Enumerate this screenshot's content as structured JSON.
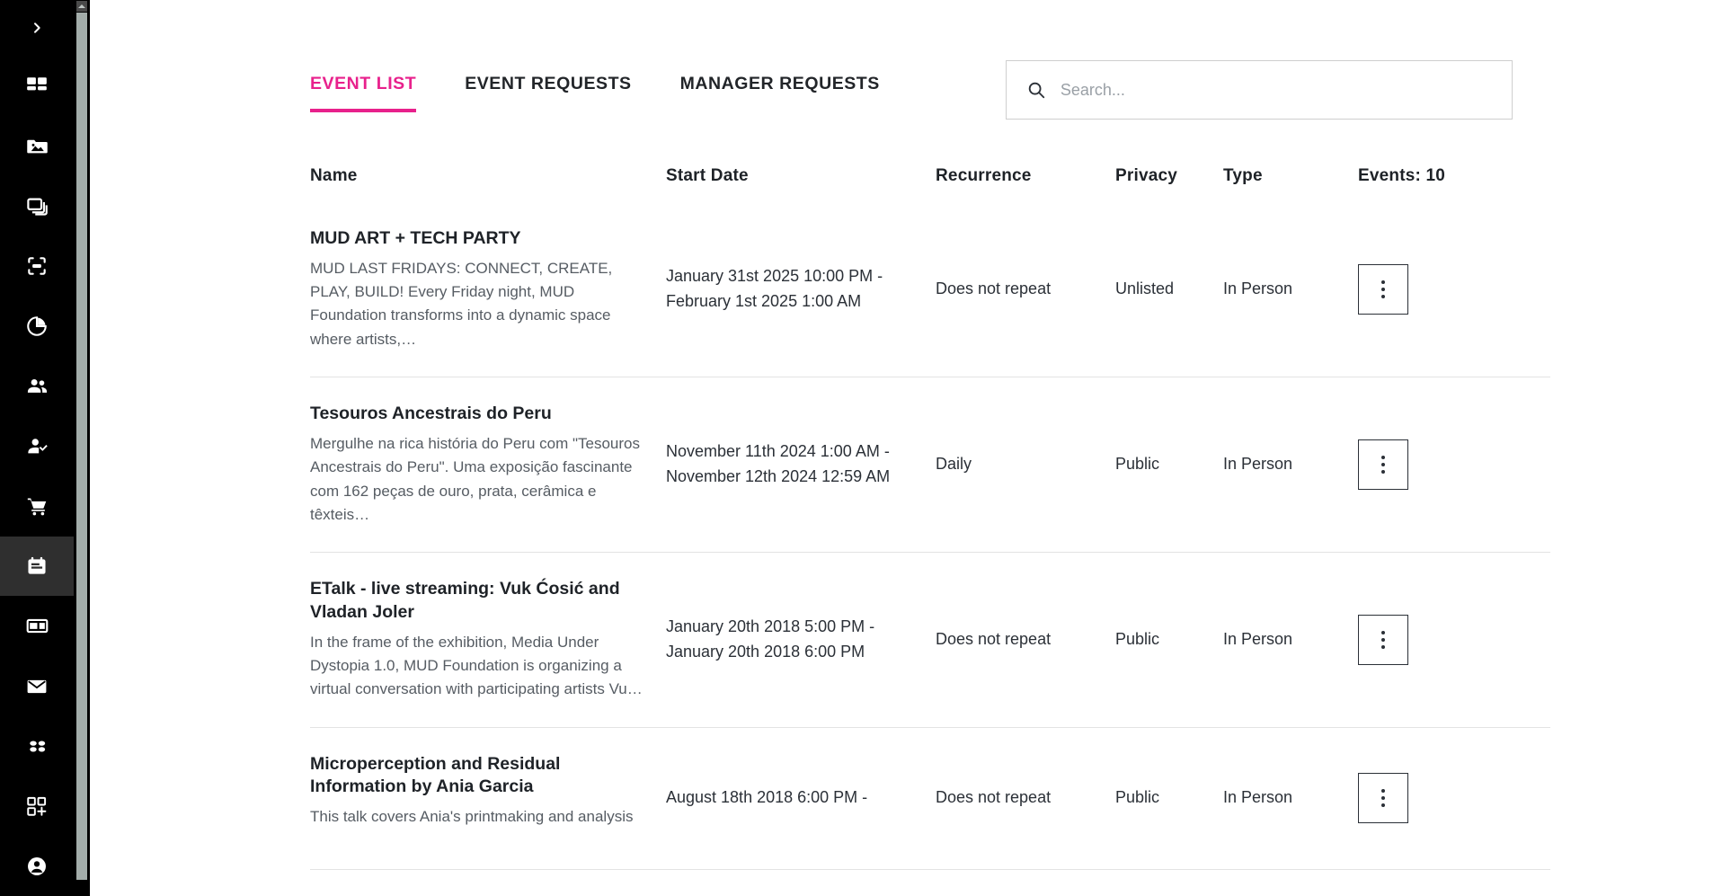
{
  "sidebar": {
    "toggle_icon": "chevron-right-icon",
    "items": [
      {
        "icon": "dashboard-icon",
        "name": "sidebar-item-dashboard",
        "active": false
      },
      {
        "icon": "media-image-icon",
        "name": "sidebar-item-media",
        "active": false
      },
      {
        "icon": "pages-copy-icon",
        "name": "sidebar-item-pages",
        "active": false
      },
      {
        "icon": "fullscreen-icon",
        "name": "sidebar-item-spaces",
        "active": false
      },
      {
        "icon": "pie-chart-icon",
        "name": "sidebar-item-analytics",
        "active": false
      },
      {
        "icon": "people-icon",
        "name": "sidebar-item-members",
        "active": false
      },
      {
        "icon": "person-check-icon",
        "name": "sidebar-item-approvals",
        "active": false
      },
      {
        "icon": "shopping-cart-icon",
        "name": "sidebar-item-store",
        "active": false
      },
      {
        "icon": "calendar-icon",
        "name": "sidebar-item-events",
        "active": true
      },
      {
        "icon": "card-layout-icon",
        "name": "sidebar-item-layouts",
        "active": false
      },
      {
        "icon": "mail-icon",
        "name": "sidebar-item-messages",
        "active": false
      },
      {
        "icon": "dots-grid-icon",
        "name": "sidebar-item-integrations",
        "active": false
      },
      {
        "icon": "add-widget-icon",
        "name": "sidebar-item-apps",
        "active": false
      },
      {
        "icon": "account-icon",
        "name": "sidebar-item-account",
        "active": false
      }
    ]
  },
  "tabs": [
    {
      "label": "EVENT LIST",
      "active": true
    },
    {
      "label": "EVENT REQUESTS",
      "active": false
    },
    {
      "label": "MANAGER REQUESTS",
      "active": false
    }
  ],
  "search": {
    "icon": "search-icon",
    "value": "",
    "placeholder": "Search..."
  },
  "table": {
    "headers": {
      "name": "Name",
      "start_date": "Start Date",
      "recurrence": "Recurrence",
      "privacy": "Privacy",
      "type": "Type",
      "count": "Events: 10"
    },
    "rows": [
      {
        "title": "MUD ART + TECH PARTY",
        "description": "MUD LAST FRIDAYS: CONNECT, CREATE, PLAY, BUILD! Every Friday night, MUD Foundation transforms into a dynamic space where artists,…",
        "start_date": "January 31st 2025 10:00 PM - February 1st 2025 1:00 AM",
        "recurrence": "Does not repeat",
        "privacy": "Unlisted",
        "type": "In Person",
        "menu_icon": "kebab-menu-icon"
      },
      {
        "title": "Tesouros Ancestrais do Peru",
        "description": "Mergulhe na rica história do Peru com \"Tesouros Ancestrais do Peru\". Uma exposição fascinante com 162 peças de ouro, prata, cerâmica e têxteis…",
        "start_date": "November 11th 2024 1:00 AM - November 12th 2024 12:59 AM",
        "recurrence": "Daily",
        "privacy": "Public",
        "type": "In Person",
        "menu_icon": "kebab-menu-icon"
      },
      {
        "title": "ETalk - live streaming: Vuk Ćosić and Vladan Joler",
        "description": "In the frame of the exhibition, Media Under Dystopia 1.0, MUD Foundation is organizing a virtual conversation with participating artists Vu…",
        "start_date": "January 20th 2018 5:00 PM - January 20th 2018 6:00 PM",
        "recurrence": "Does not repeat",
        "privacy": "Public",
        "type": "In Person",
        "menu_icon": "kebab-menu-icon"
      },
      {
        "title": "Microperception and Residual Information by Ania Garcia",
        "description": "This talk covers Ania's printmaking and analysis",
        "start_date": "August 18th 2018 6:00 PM -",
        "recurrence": "Does not repeat",
        "privacy": "Public",
        "type": "In Person",
        "menu_icon": "kebab-menu-icon"
      }
    ]
  },
  "colors": {
    "accent": "#e8218c",
    "sidebar_bg": "#000000",
    "sidebar_active_bg": "#2f2f2f",
    "text": "#1e2227",
    "muted_text": "#565c63",
    "divider": "#e3e3e3"
  }
}
